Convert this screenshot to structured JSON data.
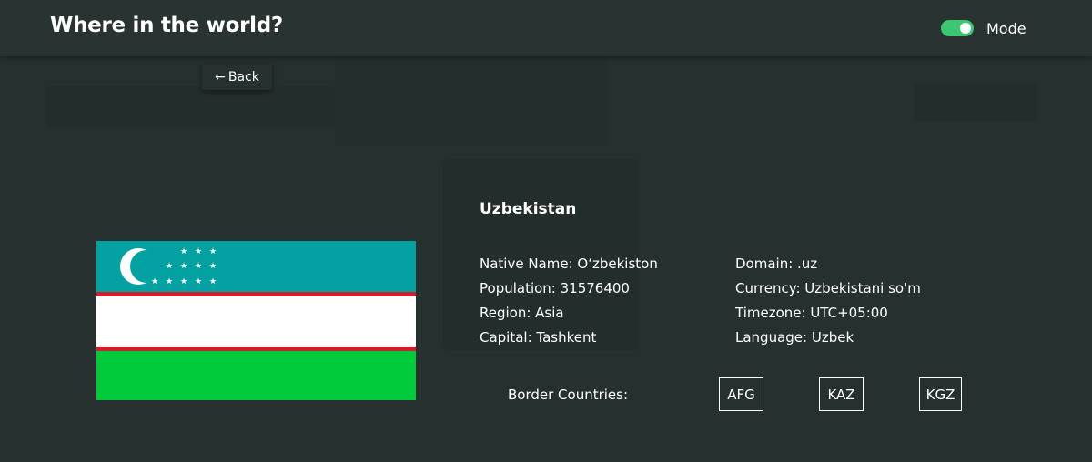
{
  "header": {
    "title": "Where in the world?",
    "mode_label": "Mode",
    "toggle_on": true,
    "toggle_color": "#3cc872"
  },
  "back": {
    "arrow": "←",
    "label": "Back"
  },
  "country": {
    "name": "Uzbekistan",
    "flag_colors": {
      "top": "#04a1a3",
      "stripe": "#cf1f2e",
      "middle": "#ffffff",
      "bottom": "#00c93a"
    },
    "left_details": [
      "Native Name: O‘zbekiston",
      "Population: 31576400",
      "Region: Asia",
      "Capital: Tashkent"
    ],
    "right_details": [
      "Domain: .uz",
      "Currency: Uzbekistani so'm",
      "Timezone: UTC+05:00",
      "Language: Uzbek"
    ],
    "border_label": "Border Countries:",
    "borders": [
      "AFG",
      "KAZ",
      "KGZ"
    ]
  }
}
